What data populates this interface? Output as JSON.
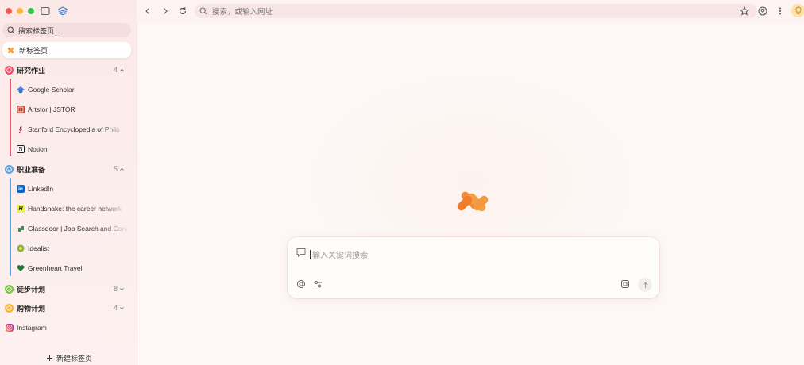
{
  "sidebar": {
    "search_placeholder": "搜索标签页...",
    "new_tab_item": "新标签页",
    "groups": [
      {
        "label": "研究作业",
        "count": "4",
        "expanded": true,
        "color": "#e8556d",
        "tabs": [
          {
            "label": "Google Scholar",
            "icon": "google-scholar-icon"
          },
          {
            "label": "Artstor | JSTOR",
            "icon": "jstor-icon"
          },
          {
            "label": "Stanford Encyclopedia of Philo",
            "icon": "stanford-icon"
          },
          {
            "label": "Notion",
            "icon": "notion-icon"
          }
        ]
      },
      {
        "label": "职业准备",
        "count": "5",
        "expanded": true,
        "color": "#5aa6e0",
        "tabs": [
          {
            "label": "LinkedIn",
            "icon": "linkedin-icon"
          },
          {
            "label": "Handshake: the career network",
            "icon": "handshake-icon"
          },
          {
            "label": "Glassdoor | Job Search and Company Reviews",
            "icon": "glassdoor-icon"
          },
          {
            "label": "Idealist",
            "icon": "idealist-icon"
          },
          {
            "label": "Greenheart Travel",
            "icon": "heart-icon"
          }
        ]
      },
      {
        "label": "徒步计划",
        "count": "8",
        "expanded": false,
        "color": "#7fc44a"
      },
      {
        "label": "购物计划",
        "count": "4",
        "expanded": false,
        "color": "#f0b43a"
      }
    ],
    "standalone_tabs": [
      {
        "label": "Instagram",
        "icon": "instagram-icon"
      }
    ],
    "new_tab_button": "新建标签页"
  },
  "toolbar": {
    "address_placeholder": "搜索，或输入网址"
  },
  "main": {
    "search_placeholder": "输入关键词搜索"
  }
}
